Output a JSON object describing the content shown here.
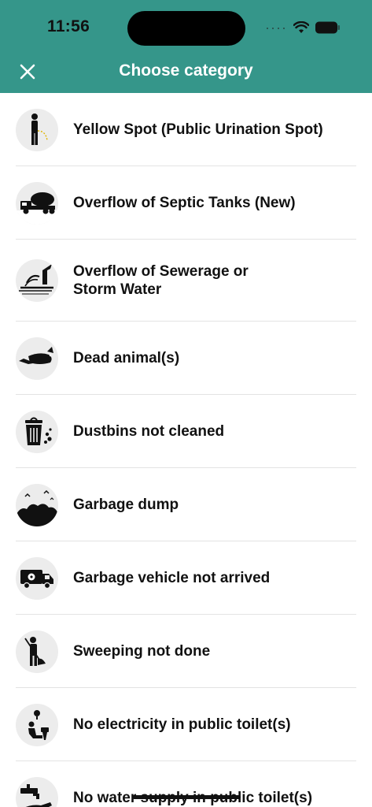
{
  "status_bar": {
    "time": "11:56",
    "signal_icon": "cellular-dots-icon",
    "wifi_icon": "wifi-icon",
    "battery_icon": "battery-icon"
  },
  "header": {
    "title": "Choose category",
    "close_icon": "close-icon",
    "background": "#35968a"
  },
  "categories": [
    {
      "label": "Yellow Spot (Public Urination Spot)",
      "icon": "urination-icon"
    },
    {
      "label": "Overflow of Septic Tanks (New)",
      "icon": "septic-tank-truck-icon"
    },
    {
      "label": "Overflow of Sewerage or\nStorm Water",
      "icon": "sewerage-overflow-icon"
    },
    {
      "label": "Dead animal(s)",
      "icon": "dead-animal-icon"
    },
    {
      "label": "Dustbins not cleaned",
      "icon": "dustbin-icon"
    },
    {
      "label": "Garbage dump",
      "icon": "garbage-dump-icon"
    },
    {
      "label": "Garbage vehicle not arrived",
      "icon": "garbage-vehicle-icon"
    },
    {
      "label": "Sweeping not done",
      "icon": "sweeper-icon"
    },
    {
      "label": "No electricity in public toilet(s)",
      "icon": "no-electricity-toilet-icon"
    },
    {
      "label": "No water supply in public toilet(s)",
      "icon": "no-water-tap-icon"
    }
  ]
}
